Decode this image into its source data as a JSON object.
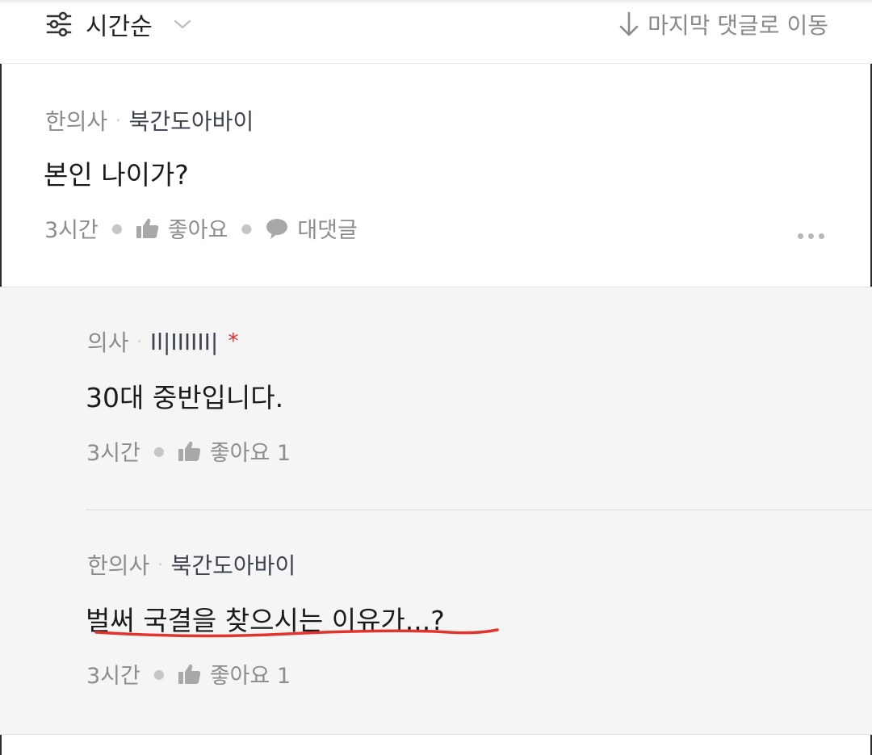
{
  "toolbar": {
    "sort_label": "시간순",
    "jump_label": "마지막 댓글로 이동"
  },
  "comments": [
    {
      "role": "한의사",
      "user": "북간도아바이",
      "text": "본인 나이가?",
      "time": "3시간",
      "like_label": "좋아요",
      "reply_label": "대댓글"
    }
  ],
  "replies": [
    {
      "role": "의사",
      "user": "Il|IIIIII|",
      "author_marker": "*",
      "text": "30대 중반입니다.",
      "time": "3시간",
      "like_label": "좋아요 1"
    },
    {
      "role": "한의사",
      "user": "북간도아바이",
      "text": "벌써 국결을 찾으시는 이유가...?",
      "time": "3시간",
      "like_label": "좋아요 1",
      "highlight_color": "#e2342f"
    }
  ]
}
